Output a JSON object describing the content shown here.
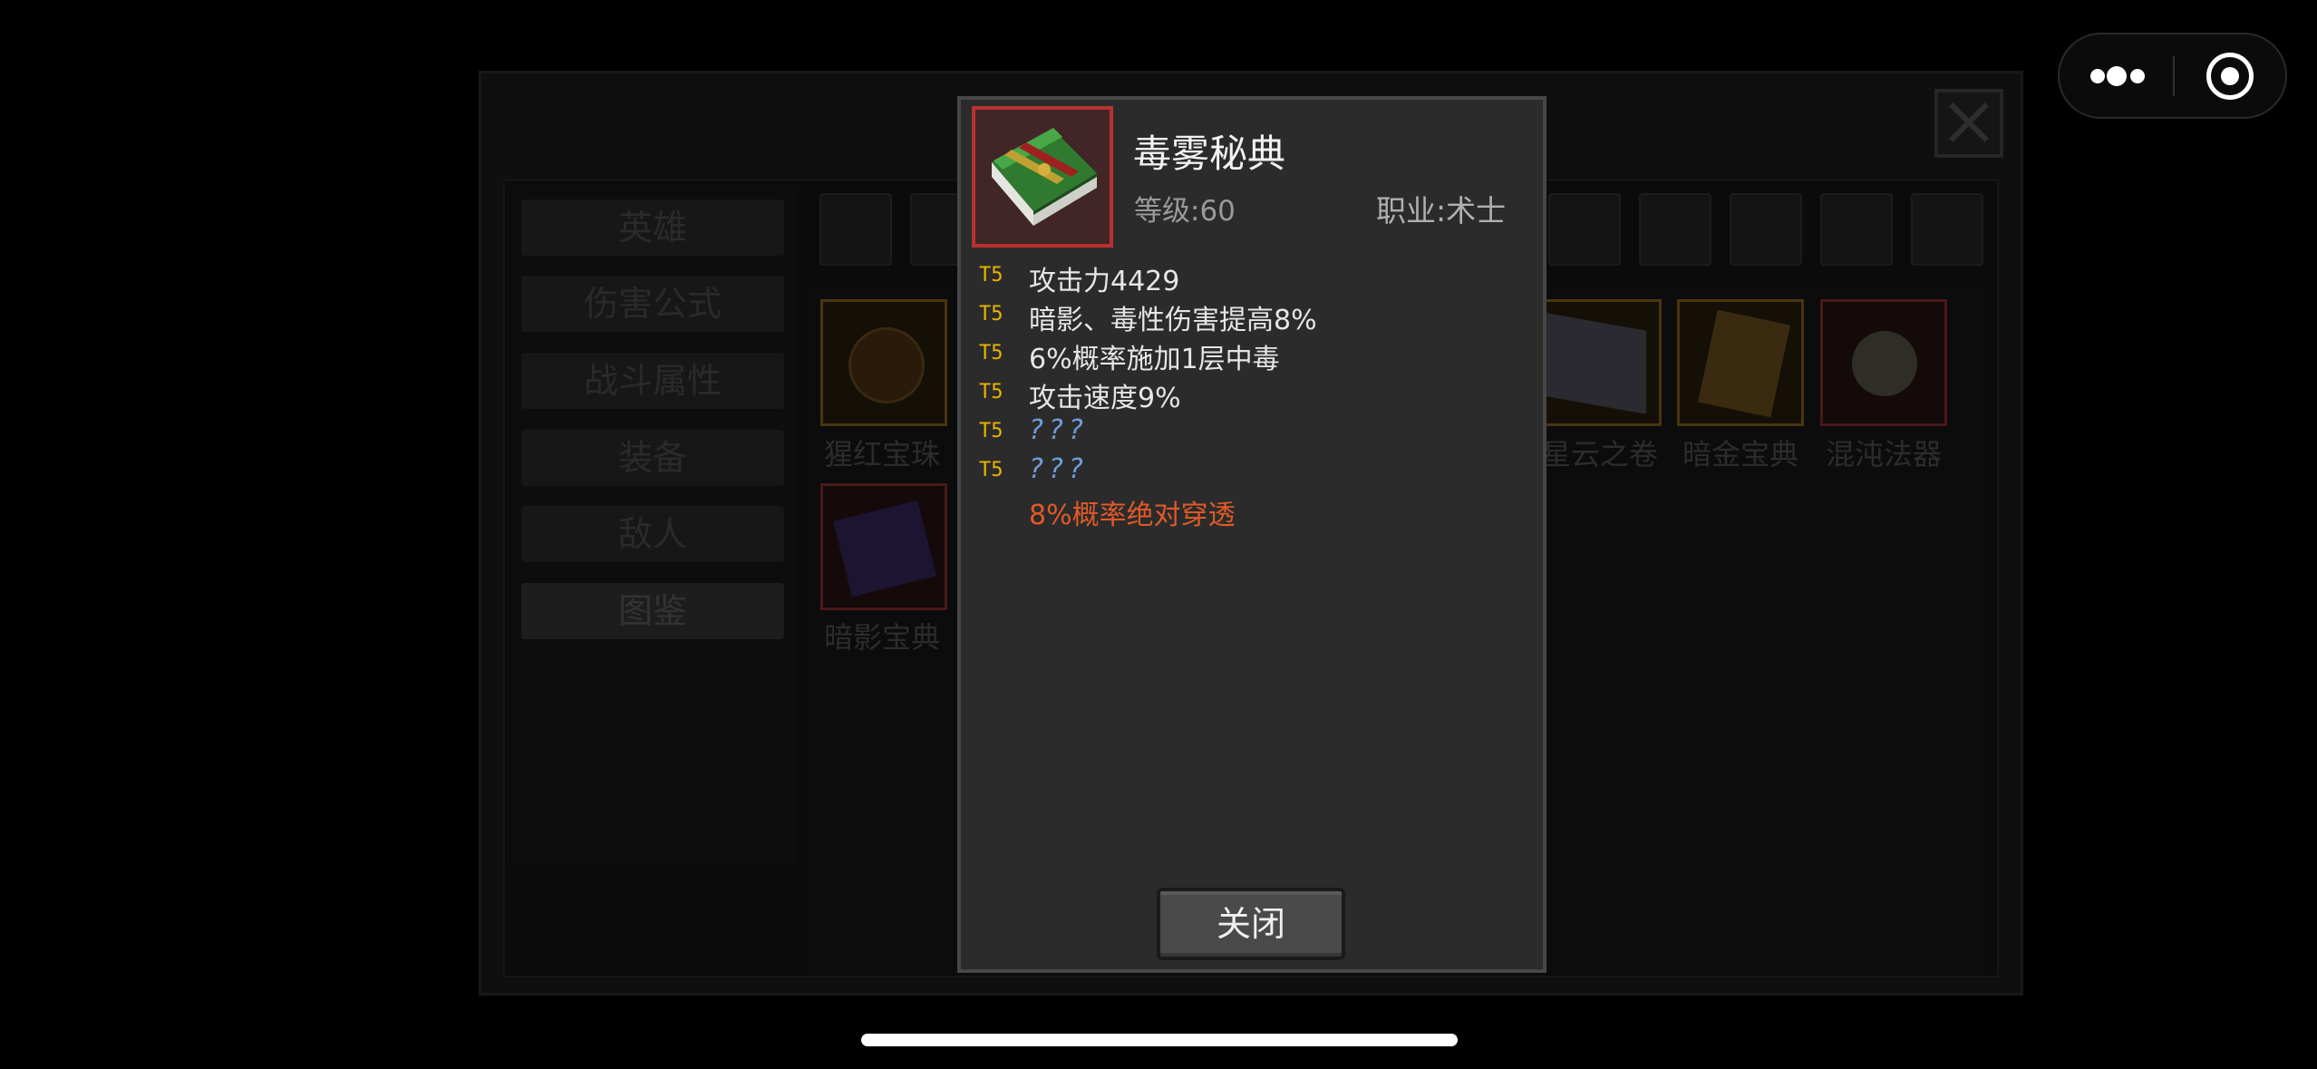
{
  "capsule": {
    "more_icon": "more-dots-icon",
    "target_icon": "target-circle-icon"
  },
  "background": {
    "menu": [
      "英雄",
      "伤害公式",
      "战斗属性",
      "装备",
      "敌人",
      "图鉴"
    ],
    "slots": [
      {
        "label": "猩红宝珠",
        "border": "#5a3f10"
      },
      {
        "label": "星云之卷",
        "border": "#5a3f10"
      },
      {
        "label": "暗金宝典",
        "border": "#5a3f10"
      },
      {
        "label": "混沌法器",
        "border": "#5a1c1c"
      },
      {
        "label": "暗影宝典",
        "border": "#5a1c1c"
      }
    ]
  },
  "item": {
    "name": "毒雾秘典",
    "level": "等级:60",
    "class": "职业:术士",
    "icon": "green-spellbook-icon",
    "rarity_color": "#b83232",
    "stats": [
      {
        "tier": "T5",
        "text": "攻击力4429",
        "kind": "normal"
      },
      {
        "tier": "T5",
        "text": "暗影、毒性伤害提高8%",
        "kind": "normal"
      },
      {
        "tier": "T5",
        "text": "6%概率施加1层中毒",
        "kind": "normal"
      },
      {
        "tier": "T5",
        "text": "攻击速度9%",
        "kind": "normal"
      },
      {
        "tier": "T5",
        "text": "???",
        "kind": "unknown"
      },
      {
        "tier": "T5",
        "text": "???",
        "kind": "unknown"
      },
      {
        "tier": "",
        "text": "8%概率绝对穿透",
        "kind": "special"
      }
    ]
  },
  "close_button": "关闭"
}
